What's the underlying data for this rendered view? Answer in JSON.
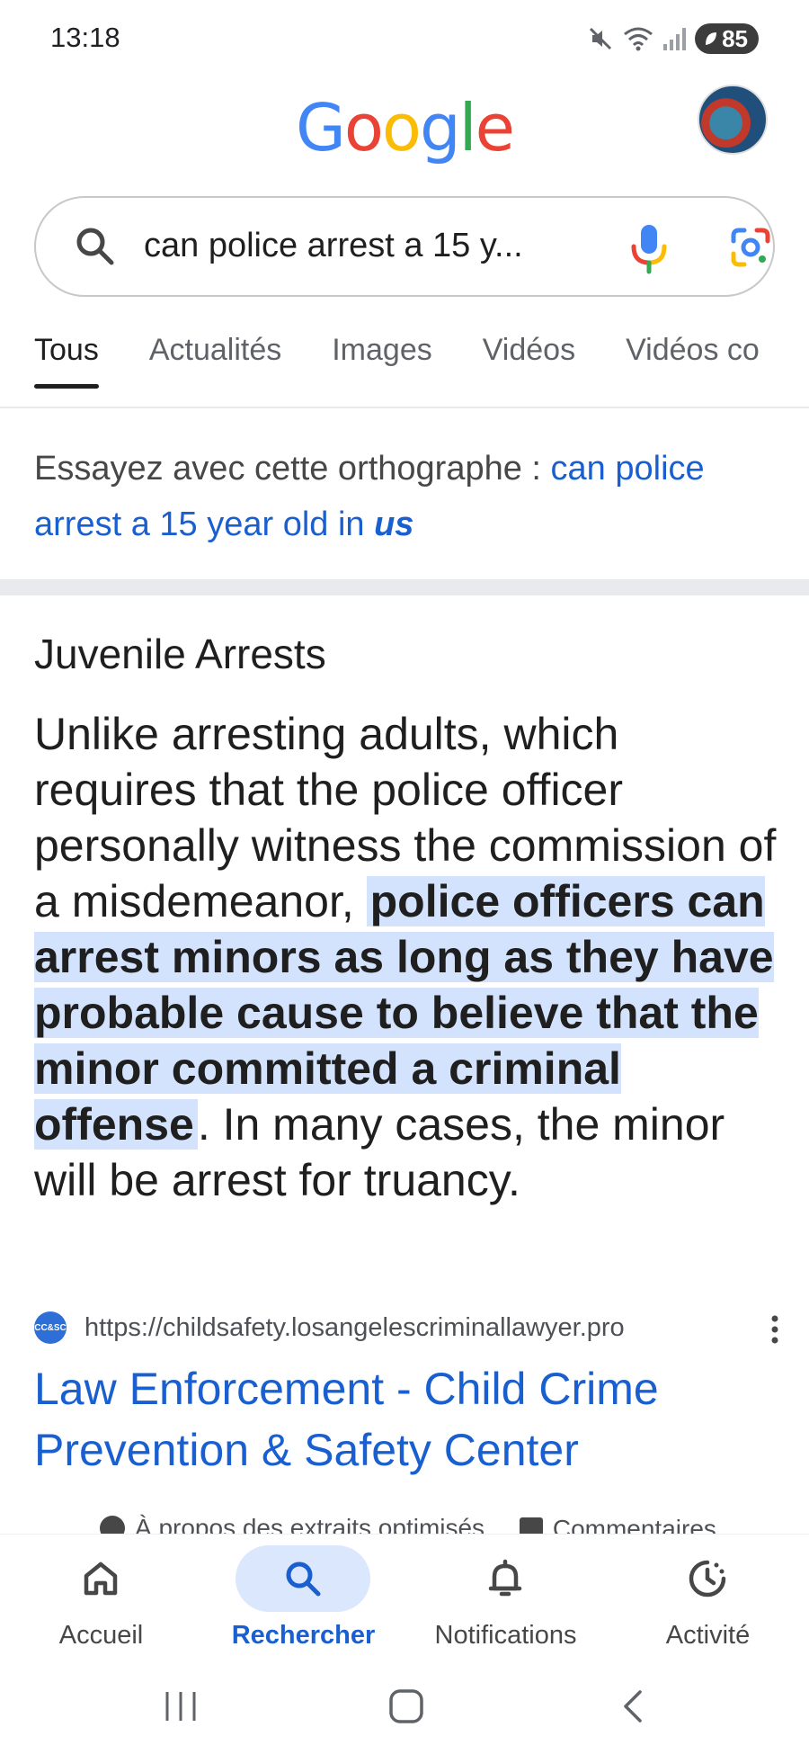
{
  "status_bar": {
    "time": "13:18",
    "battery": "85",
    "icons": [
      "mute-icon",
      "wifi-icon",
      "signal-icon",
      "battery-icon"
    ]
  },
  "header": {
    "logo_text": "Google",
    "logo_colors": [
      "#4285F4",
      "#EA4335",
      "#FBBC05",
      "#4285F4",
      "#34A853",
      "#EA4335"
    ]
  },
  "search": {
    "query": "can police arrest a 15 y..."
  },
  "tabs": [
    {
      "label": "Tous",
      "active": true
    },
    {
      "label": "Actualités",
      "active": false
    },
    {
      "label": "Images",
      "active": false
    },
    {
      "label": "Vidéos",
      "active": false
    },
    {
      "label": "Vidéos co",
      "active": false
    }
  ],
  "spelling": {
    "prefix": "Essayez avec cette orthographe : ",
    "suggestion": "can police arrest a 15 year old in ",
    "suggestion_bold": "us"
  },
  "snippet": {
    "title": "Juvenile Arrests",
    "text_before": "Unlike arresting adults, which requires that the police officer personally witness the commission of a misdemeanor, ",
    "text_highlight": "police officers can arrest minors as long as they have probable cause to believe that the minor committed a criminal offense",
    "text_after": ". In many cases, the minor will be arrest for truancy.",
    "favicon_text": "CC&SC",
    "source_url": "https://childsafety.losangelescriminallawyer.pro",
    "link_title": "Law Enforcement - Child Crime Prevention & Safety Center",
    "footer_about": "À propos des extraits optimisés",
    "footer_feedback": "Commentaires"
  },
  "bottom_nav": [
    {
      "label": "Accueil",
      "icon": "home-icon",
      "active": false
    },
    {
      "label": "Rechercher",
      "icon": "search-icon",
      "active": true
    },
    {
      "label": "Notifications",
      "icon": "bell-icon",
      "active": false
    },
    {
      "label": "Activité",
      "icon": "activity-icon",
      "active": false
    }
  ],
  "colors": {
    "link_blue": "#1a5fd0",
    "highlight": "#d3e3fd",
    "active_pill": "#dbe7fd"
  }
}
